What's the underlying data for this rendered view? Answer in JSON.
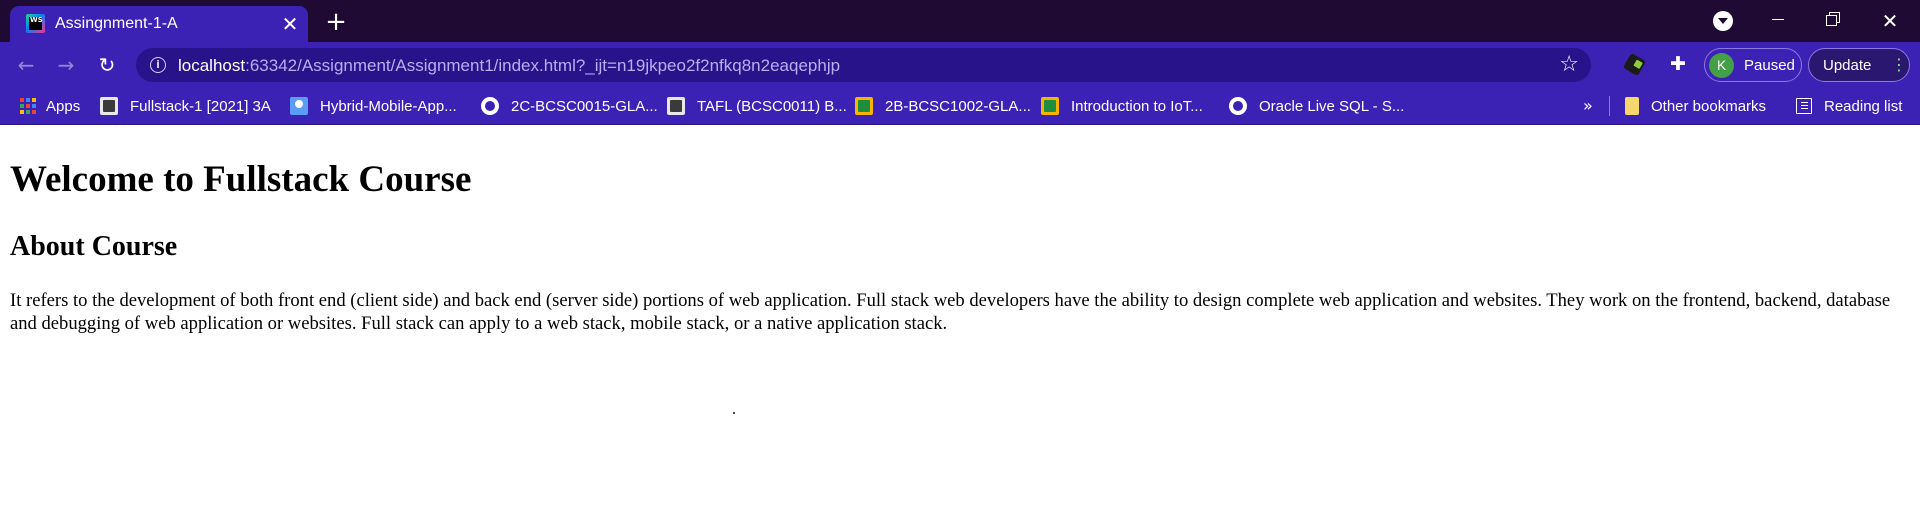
{
  "browser": {
    "tab": {
      "title": "Assingnment-1-A",
      "close_glyph": "✕",
      "favicon": "webstorm-icon"
    },
    "new_tab_glyph": "+",
    "window_controls": {
      "close_glyph": "✕"
    },
    "toolbar": {
      "back_glyph": "←",
      "forward_glyph": "→",
      "reload_glyph": "↻",
      "url_host": "localhost",
      "url_rest": ":63342/Assignment/Assignment1/index.html?_ijt=n19jkpeo2f2nfkq8n2eaqephjp",
      "info_glyph": "i",
      "star_glyph": "☆",
      "puzzle_glyph": "✚",
      "profile": {
        "initial": "K",
        "status": "Paused"
      },
      "update_label": "Update",
      "update_menu_glyph": "⋮"
    },
    "bookmarks": [
      {
        "label": "Apps",
        "icon": "apps-grid-icon"
      },
      {
        "label": "Fullstack-1 [2021] 3A",
        "icon": "classroom-icon"
      },
      {
        "label": "Hybrid-Mobile-App...",
        "icon": "classroom-blue-icon"
      },
      {
        "label": "2C-BCSC0015-GLA...",
        "icon": "globe-icon"
      },
      {
        "label": "TAFL (BCSC0011) B...",
        "icon": "classroom-icon"
      },
      {
        "label": "2B-BCSC1002-GLA...",
        "icon": "classroom-yellow-icon"
      },
      {
        "label": "Introduction to IoT...",
        "icon": "classroom-yellow-icon"
      },
      {
        "label": "Oracle Live SQL - S...",
        "icon": "globe-icon"
      }
    ],
    "bookmarks_overflow_glyph": "»",
    "other_bookmarks": "Other bookmarks",
    "reading_list": "Reading list",
    "colors": {
      "tab_strip": "#1e0a33",
      "toolbar": "#3c22b4",
      "omnibox": "#28138a"
    }
  },
  "page": {
    "heading": "Welcome to Fullstack Course",
    "subheading": "About Course",
    "paragraph": "It refers to the development of both front end (client side) and back end (server side) portions of web application. Full stack web developers have the ability to design complete web application and websites. They work on the frontend, backend, database and debugging of web application or websites. Full stack can apply to a web stack, mobile stack, or a native application stack."
  }
}
